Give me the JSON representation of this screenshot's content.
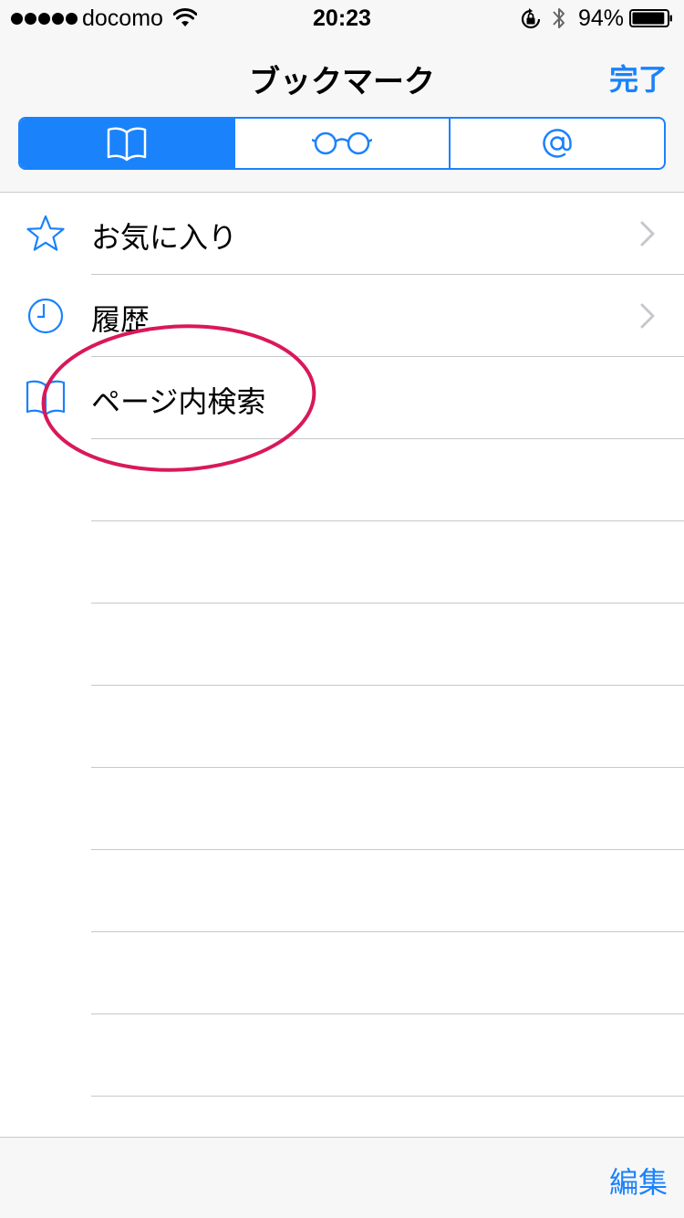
{
  "status_bar": {
    "carrier": "docomo",
    "time": "20:23",
    "battery_percent": "94%",
    "battery_level": 0.94,
    "signal_bars": 5
  },
  "nav": {
    "title": "ブックマーク",
    "done_label": "完了",
    "segments": [
      {
        "icon": "book-icon",
        "selected": true
      },
      {
        "icon": "glasses-icon",
        "selected": false
      },
      {
        "icon": "at-icon",
        "selected": false
      }
    ]
  },
  "list": {
    "items": [
      {
        "label": "お気に入り",
        "icon": "star-icon",
        "has_chevron": true
      },
      {
        "label": "履歴",
        "icon": "clock-icon",
        "has_chevron": true
      },
      {
        "label": "ページ内検索",
        "icon": "book-icon",
        "has_chevron": false,
        "highlighted": true
      }
    ]
  },
  "toolbar": {
    "edit_label": "編集"
  },
  "colors": {
    "accent": "#1a82fb",
    "highlight": "#d9185b",
    "separator": "#c8c7cc",
    "bar_background": "#f7f7f7"
  }
}
